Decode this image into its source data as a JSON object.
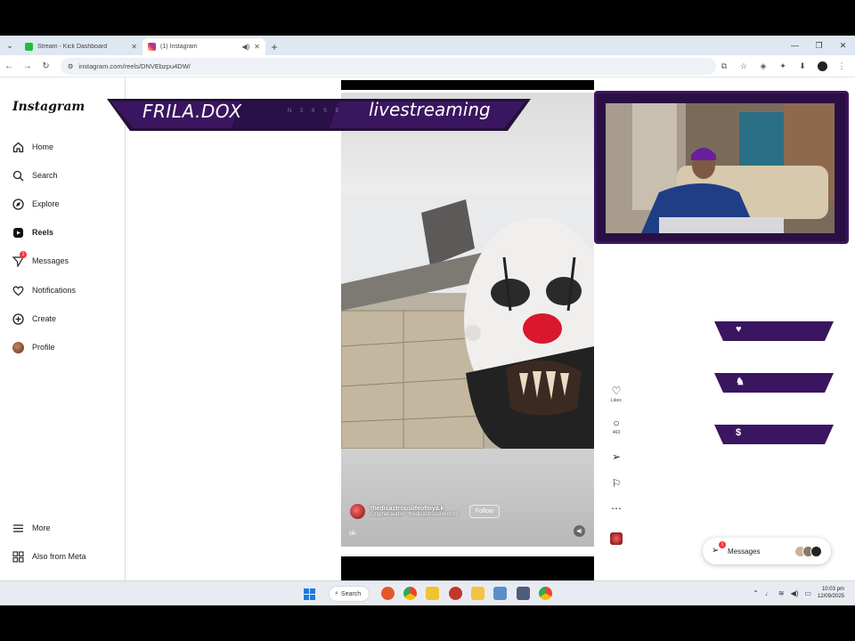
{
  "browser": {
    "tabs": [
      {
        "title": "Stream - Kick Dashboard",
        "favicon_color": "#1ebd3c",
        "active": false
      },
      {
        "title": "(1) Instagram",
        "favicon_color": "#d62976",
        "active": true
      }
    ],
    "url": "instagram.com/reels/DNVEbzpu4DW/"
  },
  "instagram": {
    "logo": "Instagram",
    "nav": [
      {
        "label": "Home",
        "icon": "home-icon"
      },
      {
        "label": "Search",
        "icon": "search-icon"
      },
      {
        "label": "Explore",
        "icon": "compass-icon"
      },
      {
        "label": "Reels",
        "icon": "reels-icon"
      },
      {
        "label": "Messages",
        "icon": "messenger-icon",
        "badge": "1"
      },
      {
        "label": "Notifications",
        "icon": "heart-icon"
      },
      {
        "label": "Create",
        "icon": "plus-square-icon"
      },
      {
        "label": "Profile",
        "icon": "avatar"
      }
    ],
    "more": "More",
    "also_from_meta": "Also from Meta",
    "reel": {
      "username": "thedisastrouslifeofmya.k",
      "audio": "Original audio · thedisastrouslifeofmy",
      "follow": "Follow",
      "caption": "ok"
    },
    "actions": {
      "likes": "Likes",
      "comments": "463"
    },
    "messages_pill": {
      "label": "Messages",
      "badge": "1"
    }
  },
  "overlay": {
    "streamer_name": "FRILA.DOX",
    "middle_text": "N 2 6 S E",
    "status": "livestreaming",
    "alerts": [
      {
        "icon": "heart-icon",
        "label": "♥"
      },
      {
        "icon": "person-icon",
        "label": "♞"
      },
      {
        "icon": "dollar-icon",
        "label": "$"
      }
    ],
    "accent": "#3b1660"
  },
  "taskbar": {
    "search_label": "Search",
    "time": "10:03 pm",
    "date": "12/09/2025"
  }
}
